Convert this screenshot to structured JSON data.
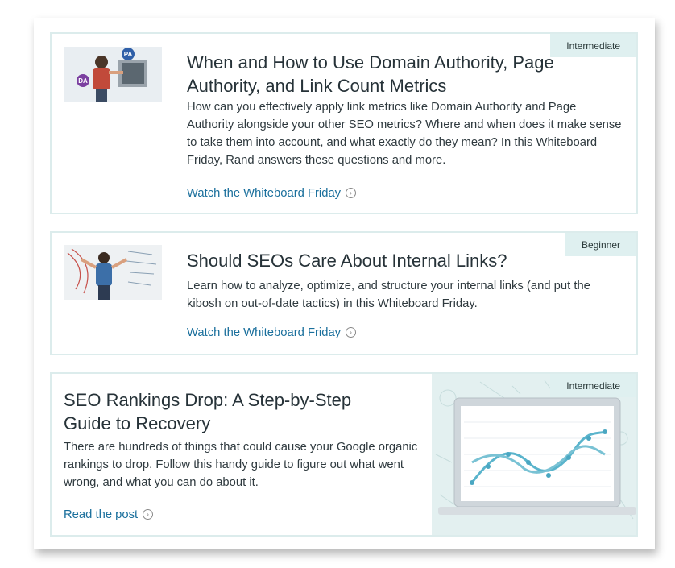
{
  "cards": [
    {
      "level": "Intermediate",
      "title": "When and How to Use Domain Authority, Page Authority, and Link Count Metrics",
      "description": "How can you effectively apply link metrics like Domain Authority and Page Authority alongside your other SEO metrics? Where and when does it make sense to take them into account, and what exactly do they mean? In this Whiteboard Friday, Rand answers these questions and more.",
      "link": "Watch the Whiteboard Friday",
      "thumb_badges": [
        "PA",
        "DA"
      ]
    },
    {
      "level": "Beginner",
      "title": "Should SEOs Care About Internal Links?",
      "description": "Learn how to analyze, optimize, and structure your internal links (and put the kibosh on out-of-date tactics) in this Whiteboard Friday.",
      "link": "Watch the Whiteboard Friday"
    },
    {
      "level": "Intermediate",
      "title": "SEO Rankings Drop: A Step-by-Step Guide to Recovery",
      "description": "There are hundreds of things that could cause your Google organic rankings to drop. Follow this handy guide to figure out what went wrong, and what you can do about it.",
      "link": "Read the post"
    }
  ],
  "icons": {
    "link_arrow": "chevron-circle-right-icon"
  },
  "colors": {
    "accent": "#1a6f9c",
    "badge_bg": "#dff0f0",
    "border": "#dcecec"
  }
}
